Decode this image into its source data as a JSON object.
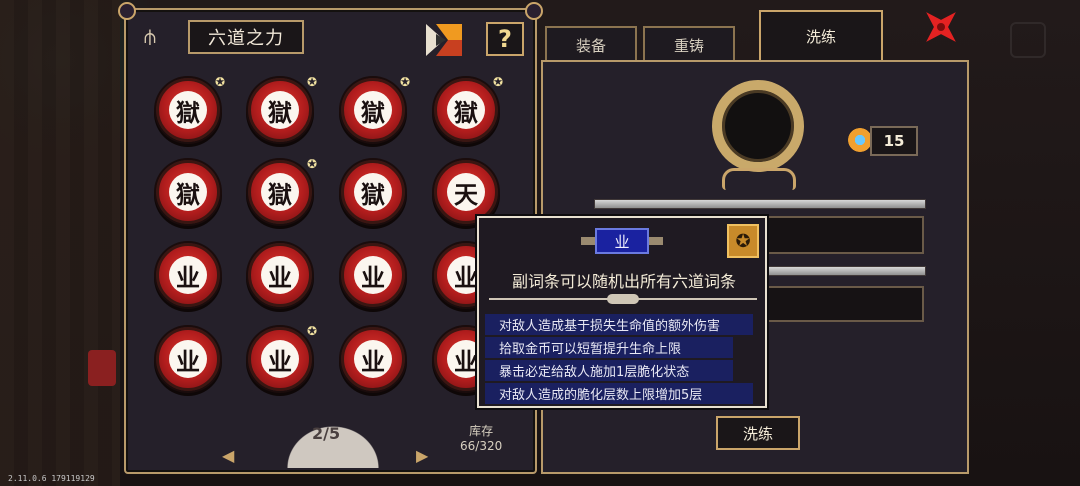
{
  "panel_title": "六道之力",
  "help_label": "?",
  "runes": [
    {
      "char": "獄",
      "starred": true
    },
    {
      "char": "獄",
      "starred": true
    },
    {
      "char": "獄",
      "starred": true
    },
    {
      "char": "獄",
      "starred": true
    },
    {
      "char": "獄",
      "starred": false
    },
    {
      "char": "獄",
      "starred": true
    },
    {
      "char": "獄",
      "starred": false
    },
    {
      "char": "天",
      "starred": false
    },
    {
      "char": "业",
      "starred": false
    },
    {
      "char": "业",
      "starred": false
    },
    {
      "char": "业",
      "starred": false
    },
    {
      "char": "业",
      "starred": false
    },
    {
      "char": "业",
      "starred": false
    },
    {
      "char": "业",
      "starred": true
    },
    {
      "char": "业",
      "starred": false
    },
    {
      "char": "业",
      "starred": false
    }
  ],
  "pagination": {
    "label": "2/5",
    "prev": "◀",
    "next": "▶"
  },
  "stock": {
    "label": "库存",
    "value": "66/320"
  },
  "tabs": [
    {
      "label": "装备",
      "active": false
    },
    {
      "label": "重铸",
      "active": false
    },
    {
      "label": "洗练",
      "active": true
    }
  ],
  "ore_count": "15",
  "wash_button": "洗练",
  "tooltip": {
    "badge": "业",
    "star": "✪",
    "title": "副词条可以随机出所有六道词条",
    "effects": [
      "对敌人造成基于损失生命值的额外伤害",
      "拾取金币可以短暂提升生命上限",
      "暴击必定给敌人施加1层脆化状态",
      "对敌人造成的脆化层数上限增加5层"
    ]
  },
  "version": "2.11.0.6 179119129",
  "colors": {
    "orb_red": "#c8201c",
    "gold_border": "#caa56a",
    "tooltip_line": "#1a2060",
    "badge_blue": "#1a22a0"
  }
}
